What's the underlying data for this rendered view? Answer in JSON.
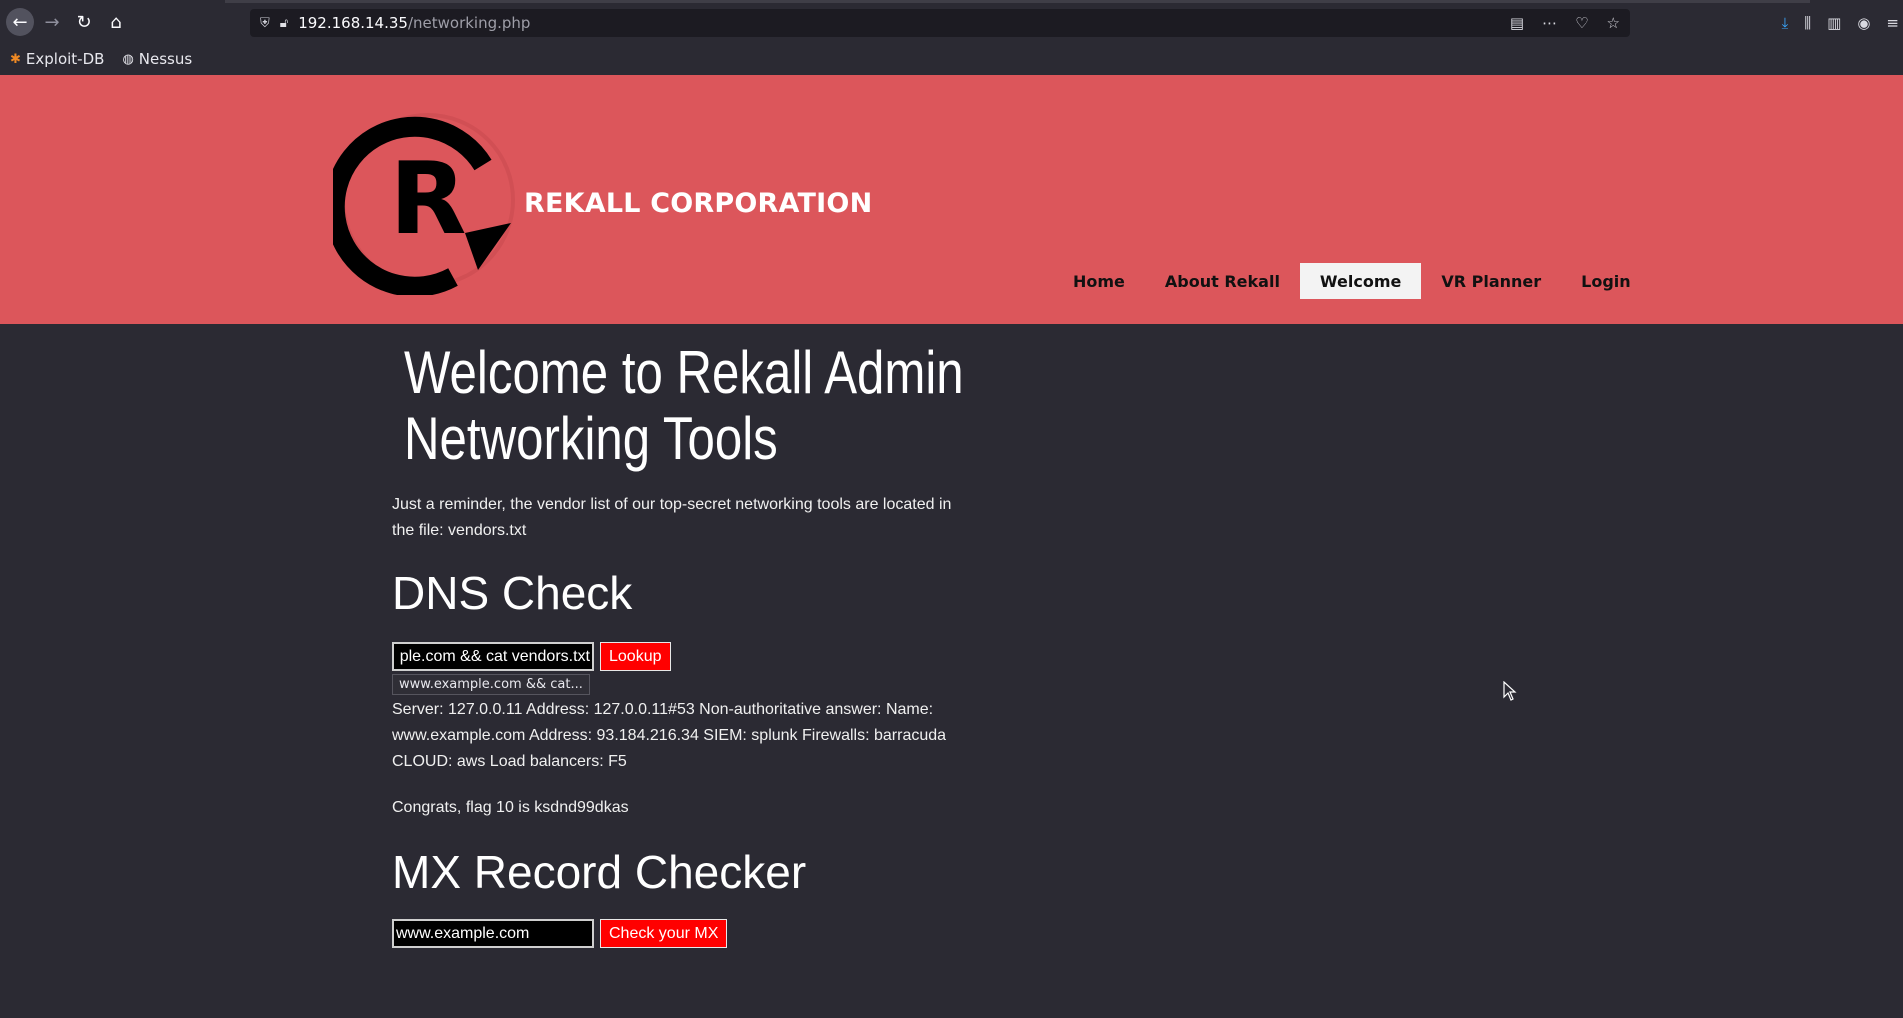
{
  "browser": {
    "url_host": "192.168.14.35",
    "url_path": "/networking.php",
    "bookmarks": [
      {
        "label": "Exploit-DB",
        "icon": "spider-icon"
      },
      {
        "label": "Nessus",
        "icon": "globe-icon"
      }
    ]
  },
  "site": {
    "brand": "REKALL CORPORATION",
    "menu": [
      {
        "label": "Home",
        "active": false
      },
      {
        "label": "About Rekall",
        "active": false
      },
      {
        "label": "Welcome",
        "active": true
      },
      {
        "label": "VR Planner",
        "active": false
      },
      {
        "label": "Login",
        "active": false
      }
    ]
  },
  "main": {
    "title_line1": "Welcome to Rekall Admin",
    "title_line2": "Networking Tools",
    "reminder": "Just a reminder, the vendor list of our top-secret networking tools are located in the file: vendors.txt",
    "dns": {
      "heading": "DNS Check",
      "input_value": "ple.com && cat vendors.txt",
      "button_label": "Lookup",
      "tooltip": "www.example.com && cat...",
      "result": "Server: 127.0.0.11 Address: 127.0.0.11#53 Non-authoritative answer: Name: www.example.com Address: 93.184.216.34 SIEM: splunk Firewalls: barracuda CLOUD: aws Load balancers: F5",
      "flag": "Congrats, flag 10 is ksdnd99dkas"
    },
    "mx": {
      "heading": "MX Record Checker",
      "input_value": "www.example.com",
      "button_label": "Check your MX"
    }
  },
  "colors": {
    "header_bg": "#dc565b",
    "page_bg": "#2b2a33",
    "button_red": "#ff0000"
  }
}
